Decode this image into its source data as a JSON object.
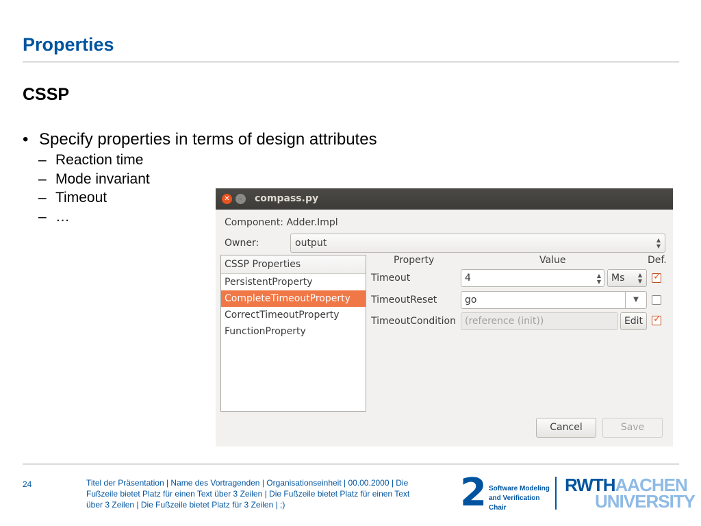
{
  "slide": {
    "title": "Properties",
    "subtitle": "CSSP",
    "bullet": "Specify properties in terms of design attributes",
    "subitems": [
      "Reaction time",
      "Mode invariant",
      "Timeout",
      "…"
    ]
  },
  "dialog": {
    "title": "compass.py",
    "component_label": "Component:",
    "component_value": "Adder.Impl",
    "owner_label": "Owner:",
    "owner_value": "output",
    "list_header": "CSSP Properties",
    "list_items": [
      "PersistentProperty",
      "CompleteTimeoutProperty",
      "CorrectTimeoutProperty",
      "FunctionProperty"
    ],
    "selected_index": 1,
    "columns": {
      "property": "Property",
      "value": "Value",
      "def": "Def."
    },
    "rows": [
      {
        "name": "Timeout",
        "value": "4",
        "unit": "Ms",
        "def": true
      },
      {
        "name": "TimeoutReset",
        "value": "go",
        "def": false
      },
      {
        "name": "TimeoutCondition",
        "value": "(reference (init))",
        "button": "Edit",
        "def": true
      }
    ],
    "cancel": "Cancel",
    "save": "Save"
  },
  "footer": {
    "page": "24",
    "text": "Titel der Präsentation  |  Name des Vortragenden  |  Organisationseinheit  |  00.00.2000  |  Die Fußzeile bietet Platz für einen Text über 3 Zeilen  |  Die Fußzeile bietet Platz für einen Text über 3 Zeilen  |  Die Fußzeile bietet Platz für 3 Zeilen  | ;)",
    "logo_number": "2",
    "logo_line1": "Software Modeling",
    "logo_line2": "and Verification Chair",
    "univ_rwth": "RWTH",
    "univ_aachen": "AACHEN",
    "univ_university": "UNIVERSITY"
  },
  "colors": {
    "accent": "#00549f",
    "selection": "#f07746"
  }
}
